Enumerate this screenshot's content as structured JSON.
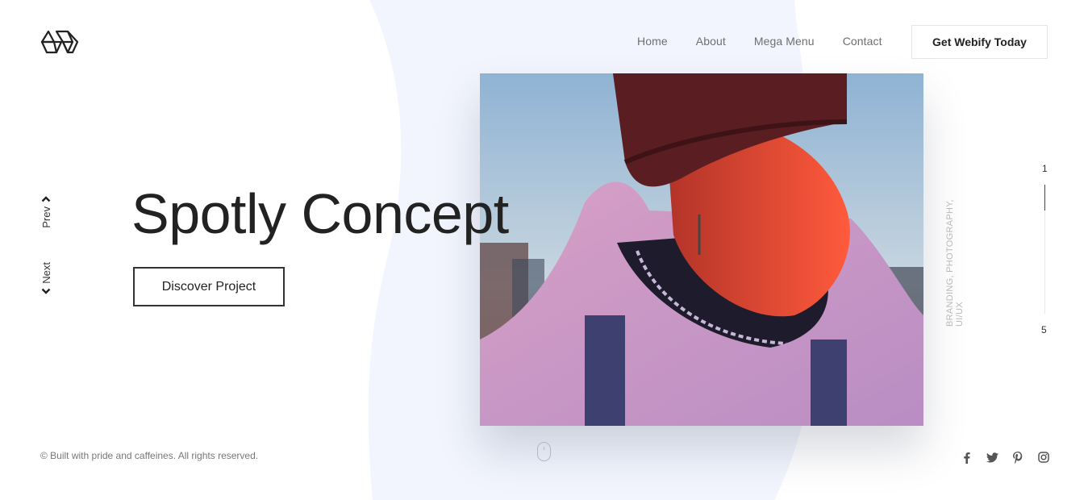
{
  "brand": {
    "logo_icon": "hexagon-cube-logo"
  },
  "nav": {
    "items": [
      {
        "label": "Home"
      },
      {
        "label": "About"
      },
      {
        "label": "Mega Menu"
      },
      {
        "label": "Contact"
      }
    ],
    "cta_label": "Get Webify Today"
  },
  "hero": {
    "title": "Spotly Concept",
    "button_label": "Discover Project",
    "tags": "BRANDING, PHOTOGRAPHY, UI/UX",
    "image_icon": "portrait-photo"
  },
  "slider": {
    "prev_label": "Prev",
    "next_label": "Next",
    "prev_icon": "chevron-up-icon",
    "next_icon": "chevron-down-icon",
    "current": "1",
    "total": "5",
    "progress": 0.2
  },
  "footer": {
    "copyright": "© Built with pride and caffeines. All rights reserved.",
    "scroll_icon": "mouse-icon",
    "social": [
      {
        "name": "facebook-icon",
        "glyph": "f"
      },
      {
        "name": "twitter-icon"
      },
      {
        "name": "pinterest-icon"
      },
      {
        "name": "instagram-icon"
      }
    ]
  },
  "colors": {
    "background": "#ffffff",
    "blob": "#f2f5fd",
    "text": "#222222",
    "muted": "#6f6f6f"
  }
}
